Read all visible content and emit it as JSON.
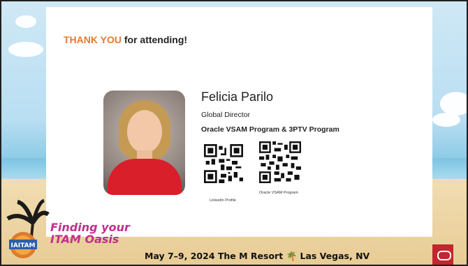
{
  "slide": {
    "title_accent": "THANK YOU",
    "title_rest": " for attending!"
  },
  "speaker": {
    "name": "Felicia Parilo",
    "role": "Global Director",
    "program": "Oracle VSAM Program & 3PTV Program"
  },
  "qr_codes": [
    {
      "label": "LinkedIn Profile"
    },
    {
      "label": "Oracle VSAM Program"
    }
  ],
  "branding": {
    "logo_text": "IAITAM",
    "tagline_line1": "Finding your",
    "tagline_line2": "ITAM Oasis",
    "event": "May 7–9, 2024  The M Resort",
    "location": "Las Vegas, NV"
  },
  "colors": {
    "accent": "#e8782f",
    "oracle_red": "#c2272d",
    "tagline": "#c22f8f"
  }
}
